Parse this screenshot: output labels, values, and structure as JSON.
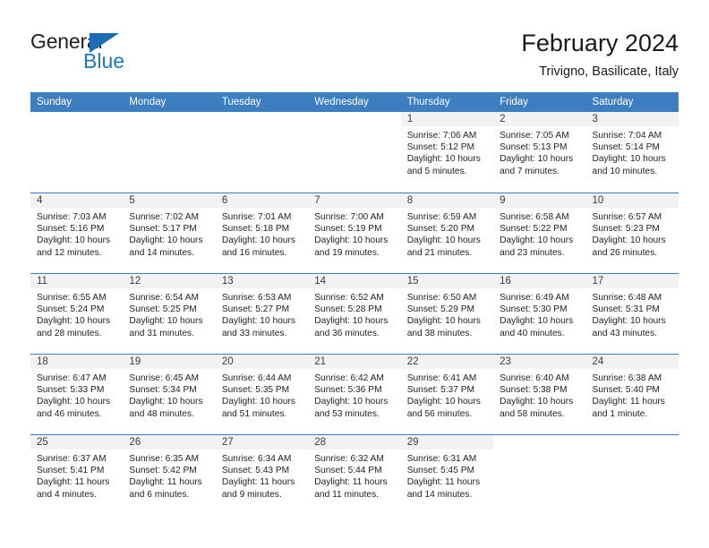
{
  "brand": {
    "name_top": "General",
    "name_bottom": "Blue",
    "triangle_color": "#1c6cb5",
    "blue_text_color": "#1c79c0"
  },
  "header": {
    "title": "February 2024",
    "location": "Trivigno, Basilicate, Italy"
  },
  "theme": {
    "header_blue": "#3c7ebf",
    "daynum_band": "#f2f2f2",
    "text": "#1f1f1f"
  },
  "weekdays": [
    "Sunday",
    "Monday",
    "Tuesday",
    "Wednesday",
    "Thursday",
    "Friday",
    "Saturday"
  ],
  "labels": {
    "sunrise_prefix": "Sunrise:",
    "sunset_prefix": "Sunset:",
    "daylight_prefix": "Daylight:"
  },
  "weeks": [
    [
      {
        "day": "",
        "empty": true
      },
      {
        "day": "",
        "empty": true
      },
      {
        "day": "",
        "empty": true
      },
      {
        "day": "",
        "empty": true
      },
      {
        "day": "1",
        "sunrise": "Sunrise: 7:06 AM",
        "sunset": "Sunset: 5:12 PM",
        "daylight": "Daylight: 10 hours and 5 minutes."
      },
      {
        "day": "2",
        "sunrise": "Sunrise: 7:05 AM",
        "sunset": "Sunset: 5:13 PM",
        "daylight": "Daylight: 10 hours and 7 minutes."
      },
      {
        "day": "3",
        "sunrise": "Sunrise: 7:04 AM",
        "sunset": "Sunset: 5:14 PM",
        "daylight": "Daylight: 10 hours and 10 minutes."
      }
    ],
    [
      {
        "day": "4",
        "sunrise": "Sunrise: 7:03 AM",
        "sunset": "Sunset: 5:16 PM",
        "daylight": "Daylight: 10 hours and 12 minutes."
      },
      {
        "day": "5",
        "sunrise": "Sunrise: 7:02 AM",
        "sunset": "Sunset: 5:17 PM",
        "daylight": "Daylight: 10 hours and 14 minutes."
      },
      {
        "day": "6",
        "sunrise": "Sunrise: 7:01 AM",
        "sunset": "Sunset: 5:18 PM",
        "daylight": "Daylight: 10 hours and 16 minutes."
      },
      {
        "day": "7",
        "sunrise": "Sunrise: 7:00 AM",
        "sunset": "Sunset: 5:19 PM",
        "daylight": "Daylight: 10 hours and 19 minutes."
      },
      {
        "day": "8",
        "sunrise": "Sunrise: 6:59 AM",
        "sunset": "Sunset: 5:20 PM",
        "daylight": "Daylight: 10 hours and 21 minutes."
      },
      {
        "day": "9",
        "sunrise": "Sunrise: 6:58 AM",
        "sunset": "Sunset: 5:22 PM",
        "daylight": "Daylight: 10 hours and 23 minutes."
      },
      {
        "day": "10",
        "sunrise": "Sunrise: 6:57 AM",
        "sunset": "Sunset: 5:23 PM",
        "daylight": "Daylight: 10 hours and 26 minutes."
      }
    ],
    [
      {
        "day": "11",
        "sunrise": "Sunrise: 6:55 AM",
        "sunset": "Sunset: 5:24 PM",
        "daylight": "Daylight: 10 hours and 28 minutes."
      },
      {
        "day": "12",
        "sunrise": "Sunrise: 6:54 AM",
        "sunset": "Sunset: 5:25 PM",
        "daylight": "Daylight: 10 hours and 31 minutes."
      },
      {
        "day": "13",
        "sunrise": "Sunrise: 6:53 AM",
        "sunset": "Sunset: 5:27 PM",
        "daylight": "Daylight: 10 hours and 33 minutes."
      },
      {
        "day": "14",
        "sunrise": "Sunrise: 6:52 AM",
        "sunset": "Sunset: 5:28 PM",
        "daylight": "Daylight: 10 hours and 36 minutes."
      },
      {
        "day": "15",
        "sunrise": "Sunrise: 6:50 AM",
        "sunset": "Sunset: 5:29 PM",
        "daylight": "Daylight: 10 hours and 38 minutes."
      },
      {
        "day": "16",
        "sunrise": "Sunrise: 6:49 AM",
        "sunset": "Sunset: 5:30 PM",
        "daylight": "Daylight: 10 hours and 40 minutes."
      },
      {
        "day": "17",
        "sunrise": "Sunrise: 6:48 AM",
        "sunset": "Sunset: 5:31 PM",
        "daylight": "Daylight: 10 hours and 43 minutes."
      }
    ],
    [
      {
        "day": "18",
        "sunrise": "Sunrise: 6:47 AM",
        "sunset": "Sunset: 5:33 PM",
        "daylight": "Daylight: 10 hours and 46 minutes."
      },
      {
        "day": "19",
        "sunrise": "Sunrise: 6:45 AM",
        "sunset": "Sunset: 5:34 PM",
        "daylight": "Daylight: 10 hours and 48 minutes."
      },
      {
        "day": "20",
        "sunrise": "Sunrise: 6:44 AM",
        "sunset": "Sunset: 5:35 PM",
        "daylight": "Daylight: 10 hours and 51 minutes."
      },
      {
        "day": "21",
        "sunrise": "Sunrise: 6:42 AM",
        "sunset": "Sunset: 5:36 PM",
        "daylight": "Daylight: 10 hours and 53 minutes."
      },
      {
        "day": "22",
        "sunrise": "Sunrise: 6:41 AM",
        "sunset": "Sunset: 5:37 PM",
        "daylight": "Daylight: 10 hours and 56 minutes."
      },
      {
        "day": "23",
        "sunrise": "Sunrise: 6:40 AM",
        "sunset": "Sunset: 5:38 PM",
        "daylight": "Daylight: 10 hours and 58 minutes."
      },
      {
        "day": "24",
        "sunrise": "Sunrise: 6:38 AM",
        "sunset": "Sunset: 5:40 PM",
        "daylight": "Daylight: 11 hours and 1 minute."
      }
    ],
    [
      {
        "day": "25",
        "sunrise": "Sunrise: 6:37 AM",
        "sunset": "Sunset: 5:41 PM",
        "daylight": "Daylight: 11 hours and 4 minutes."
      },
      {
        "day": "26",
        "sunrise": "Sunrise: 6:35 AM",
        "sunset": "Sunset: 5:42 PM",
        "daylight": "Daylight: 11 hours and 6 minutes."
      },
      {
        "day": "27",
        "sunrise": "Sunrise: 6:34 AM",
        "sunset": "Sunset: 5:43 PM",
        "daylight": "Daylight: 11 hours and 9 minutes."
      },
      {
        "day": "28",
        "sunrise": "Sunrise: 6:32 AM",
        "sunset": "Sunset: 5:44 PM",
        "daylight": "Daylight: 11 hours and 11 minutes."
      },
      {
        "day": "29",
        "sunrise": "Sunrise: 6:31 AM",
        "sunset": "Sunset: 5:45 PM",
        "daylight": "Daylight: 11 hours and 14 minutes."
      },
      {
        "day": "",
        "empty": true
      },
      {
        "day": "",
        "empty": true
      }
    ]
  ]
}
